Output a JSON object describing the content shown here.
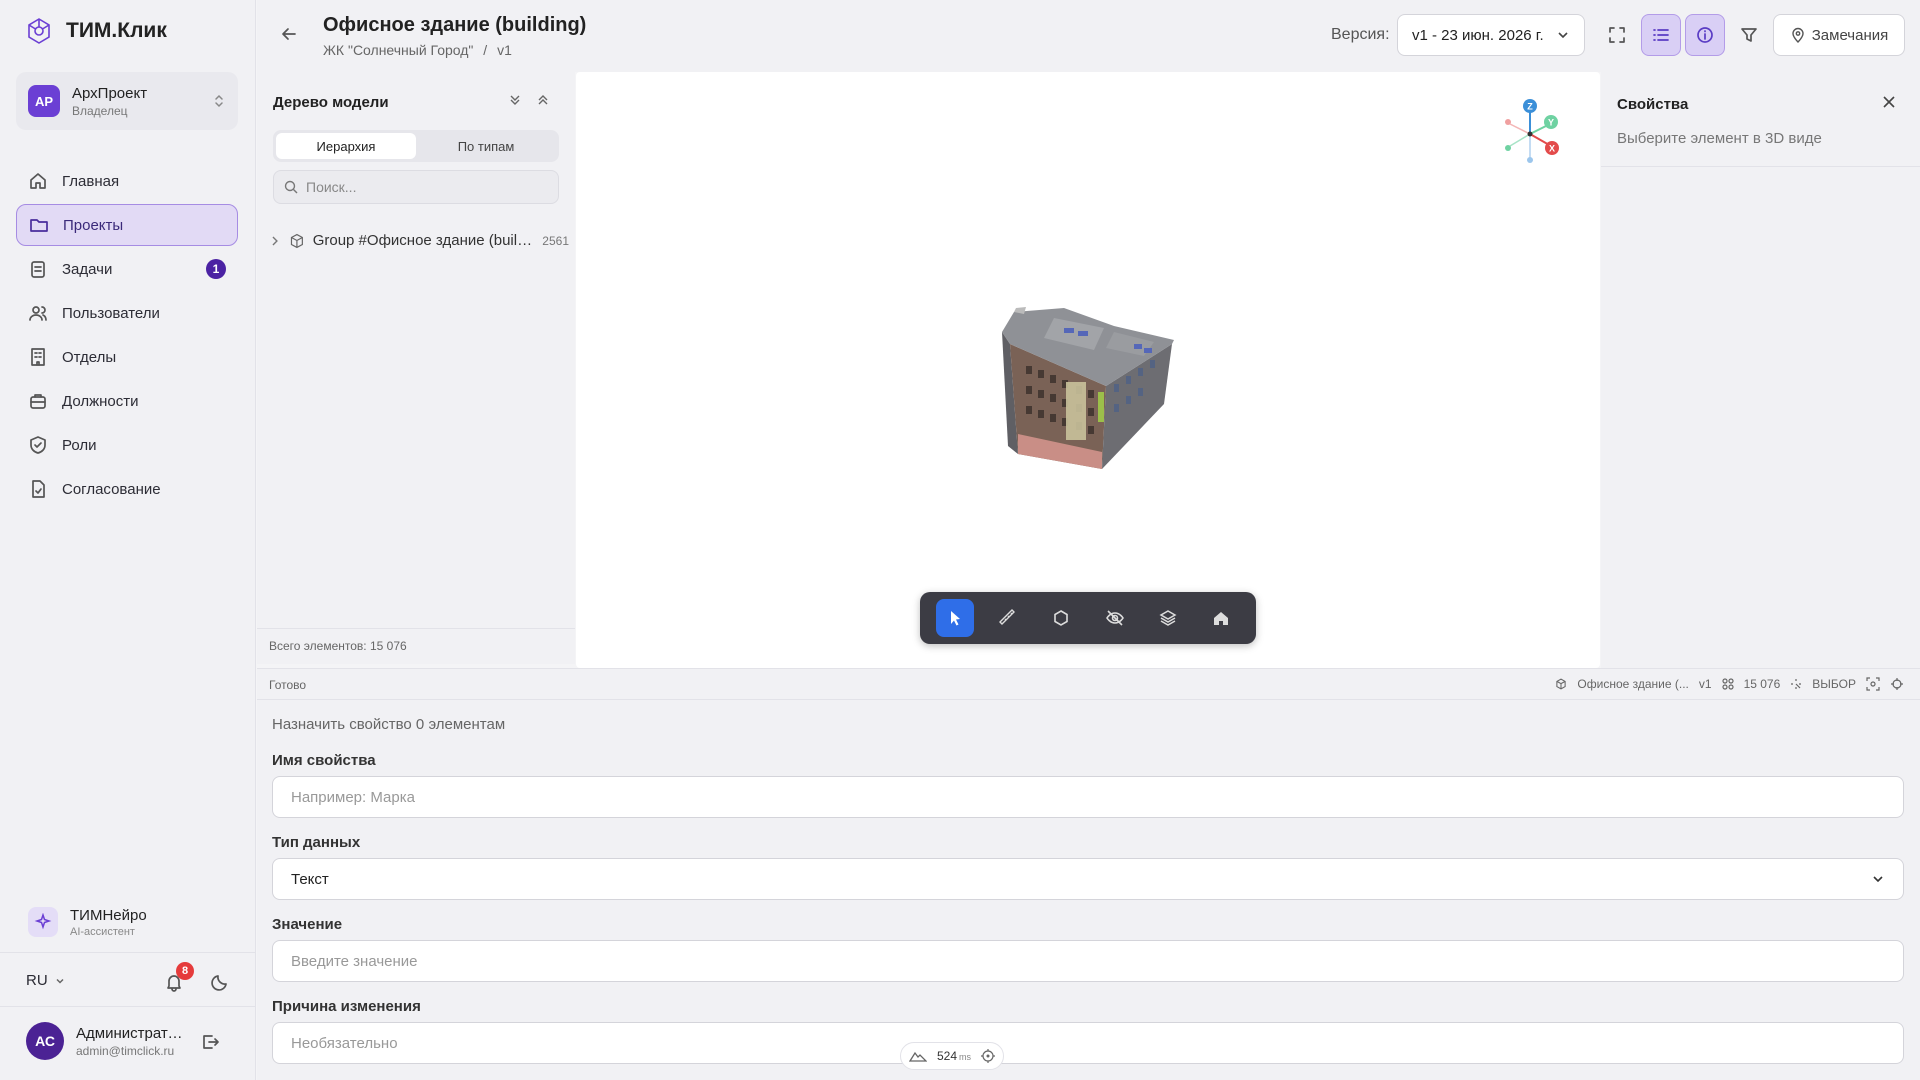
{
  "app": {
    "name": "ТИМ.Клик"
  },
  "workspace": {
    "initials": "АР",
    "name": "АрхПроект",
    "role": "Владелец"
  },
  "nav": [
    {
      "label": "Главная",
      "icon": "home-icon"
    },
    {
      "label": "Проекты",
      "icon": "folder-icon",
      "active": true
    },
    {
      "label": "Задачи",
      "icon": "tasks-icon",
      "badge": "1"
    },
    {
      "label": "Пользователи",
      "icon": "users-icon"
    },
    {
      "label": "Отделы",
      "icon": "building-icon"
    },
    {
      "label": "Должности",
      "icon": "briefcase-icon"
    },
    {
      "label": "Роли",
      "icon": "shield-icon"
    },
    {
      "label": "Согласование",
      "icon": "document-check-icon"
    }
  ],
  "assistant": {
    "name": "ТИМНейро",
    "subtitle": "AI-ассистент"
  },
  "footer": {
    "lang": "RU",
    "notifications": "8"
  },
  "user": {
    "initials": "АС",
    "name": "Администратор",
    "email": "admin@timclick.ru"
  },
  "header": {
    "title": "Офисное здание (building)",
    "breadcrumb_project": "ЖК \"Солнечный Город\"",
    "breadcrumb_sep": "/",
    "breadcrumb_version": "v1",
    "version_label": "Версия:",
    "version_value": "v1 - 23 июн. 2026 г.",
    "remarks_label": "Замечания"
  },
  "tree": {
    "title": "Дерево модели",
    "tabs": [
      "Иерархия",
      "По типам"
    ],
    "search_placeholder": "Поиск...",
    "root_label": "Group #Офисное здание (building)",
    "root_count": "2561",
    "total": "Всего элементов: 15 076"
  },
  "gizmo": {
    "z": "Z",
    "y": "Y",
    "x": "X"
  },
  "props": {
    "title": "Свойства",
    "hint": "Выберите элемент в 3D виде"
  },
  "status": {
    "ready": "Готово",
    "model": "Офисное здание (...",
    "version": "v1",
    "count": "15 076",
    "mode": "ВЫБОР"
  },
  "form": {
    "hint": "Назначить свойство 0 элементам",
    "name_label": "Имя свойства",
    "name_placeholder": "Например: Марка",
    "type_label": "Тип данных",
    "type_value": "Текст",
    "value_label": "Значение",
    "value_placeholder": "Введите значение",
    "reason_label": "Причина изменения",
    "reason_placeholder": "Необязательно"
  },
  "perf": {
    "value": "524",
    "unit": "ms"
  },
  "colors": {
    "accent": "#6b3fd4",
    "active_tool": "#2f6ee8",
    "badge": "#e53b3b"
  }
}
